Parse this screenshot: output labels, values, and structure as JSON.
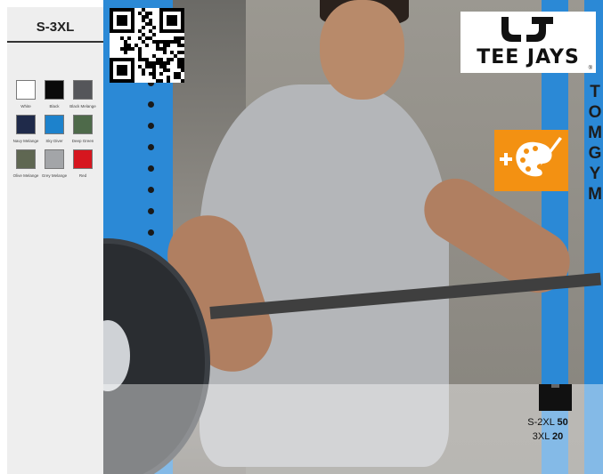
{
  "size_range": "S-3XL",
  "swatches": [
    {
      "name": "White",
      "color": "#ffffff"
    },
    {
      "name": "Black",
      "color": "#0a0a0a"
    },
    {
      "name": "Black Melange",
      "color": "#55565a"
    },
    {
      "name": "Navy Melange",
      "color": "#1f2a4a"
    },
    {
      "name": "Sky Diver",
      "color": "#1d82cc"
    },
    {
      "name": "Deep Green",
      "color": "#4e6a4a"
    },
    {
      "name": "Olive Melange",
      "color": "#5f6752"
    },
    {
      "name": "Grey Melange",
      "color": "#a3a5a8"
    },
    {
      "name": "Red",
      "color": "#d6161f"
    }
  ],
  "brand": {
    "logo_text": "TEE JAYS",
    "registered_mark": "®",
    "logo_icon": "tj-monogram-icon"
  },
  "customization_badge": {
    "icon": "plus-palette-icon",
    "color": "#f39112"
  },
  "qr_code": {
    "icon": "qr-code-icon"
  },
  "wall_letters": [
    "T",
    "O",
    "M",
    "G",
    "Y",
    "M"
  ],
  "packaging": {
    "icon": "box-icon",
    "lines": [
      {
        "size": "S-2XL",
        "qty": "50"
      },
      {
        "size": "3XL",
        "qty": "20"
      }
    ]
  }
}
